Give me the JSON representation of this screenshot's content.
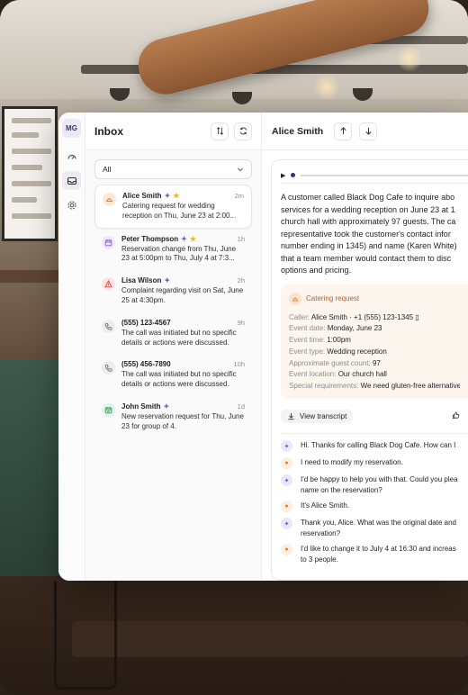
{
  "rail": {
    "avatar": "MG",
    "items": [
      {
        "icon": "gauge-icon",
        "active": false
      },
      {
        "icon": "inbox-tray-icon",
        "active": true
      },
      {
        "icon": "gear-icon",
        "active": false
      }
    ]
  },
  "inbox": {
    "title": "Inbox",
    "filter": "All",
    "conversations": [
      {
        "name": "Alice Smith",
        "time": "2m",
        "text": "Catering request for wedding reception on Thu, June 23 at 2:00...",
        "icon": "catering-icon",
        "color": "#e07a2e",
        "bg": "#fde8d6",
        "ai": true,
        "starred": true,
        "selected": true
      },
      {
        "name": "Peter Thompson",
        "time": "1h",
        "text": "Reservation change from Thu, June 23 at 5:00pm to Thu, July 4 at 7:3...",
        "icon": "calendar-icon",
        "color": "#8a5bd6",
        "bg": "#efe7fb",
        "ai": true,
        "starred": true,
        "selected": false
      },
      {
        "name": "Lisa Wilson",
        "time": "2h",
        "text": "Complaint regarding visit on Sat, June 25 at 4:30pm.",
        "icon": "warning-icon",
        "color": "#d94343",
        "bg": "#fde4e4",
        "ai": true,
        "starred": false,
        "selected": false
      },
      {
        "name": "(555) 123-4567",
        "time": "9h",
        "text": "The call was initiated but no specific details or actions were discussed.",
        "icon": "phone-icon",
        "color": "#6b6b73",
        "bg": "#ececef",
        "ai": false,
        "starred": false,
        "selected": false
      },
      {
        "name": "(555) 456-7890",
        "time": "10h",
        "text": "The call was initiated but no specific details or actions were discussed.",
        "icon": "phone-icon",
        "color": "#6b6b73",
        "bg": "#ececef",
        "ai": false,
        "starred": false,
        "selected": false
      },
      {
        "name": "John Smith",
        "time": "1d",
        "text": "New reservation request for Thu, June 23 for group of 4.",
        "icon": "calendar-check-icon",
        "color": "#2f9e5c",
        "bg": "#dff3e6",
        "ai": true,
        "starred": false,
        "selected": false
      }
    ]
  },
  "detail": {
    "title": "Alice Smith",
    "summary_lines": [
      "A customer called Black Dog Cafe to inquire abo",
      "services for a wedding reception on June 23 at 1",
      "church hall with approximately 97 guests. The ca",
      "representative took the customer's contact infor",
      "number ending in 1345) and name (Karen White)",
      "that a team member would contact them to disc",
      "options and pricing."
    ],
    "badge": "Catering request",
    "fields": [
      {
        "k": "Caller:",
        "v": "Alice Smith · +1 (555) 123-1345 ▯"
      },
      {
        "k": "Event date:",
        "v": "Monday, June 23"
      },
      {
        "k": "Event time:",
        "v": "1:00pm"
      },
      {
        "k": "Event type:",
        "v": "Wedding reception"
      },
      {
        "k": "Approximate guest count:",
        "v": "97"
      },
      {
        "k": "Event location:",
        "v": "Our church hall"
      },
      {
        "k": "Special requirements:",
        "v": "We need gluten-free alternative"
      }
    ],
    "view_transcript": "View transcript",
    "transcript": [
      {
        "role": "ai",
        "text": "Hi. Thanks for calling Black Dog Cafe. How can I"
      },
      {
        "role": "user",
        "text": "I need to modify my reservation."
      },
      {
        "role": "ai",
        "text": "I'd be happy to help you with that. Could you plea\nname on the reservation?"
      },
      {
        "role": "user",
        "text": "It's Alice Smith."
      },
      {
        "role": "ai",
        "text": "Thank you, Alice. What was the original date and\nreservation?"
      },
      {
        "role": "user",
        "text": "I'd like to change it to July 4 at 16:30 and increas\nto 3 people."
      }
    ]
  }
}
